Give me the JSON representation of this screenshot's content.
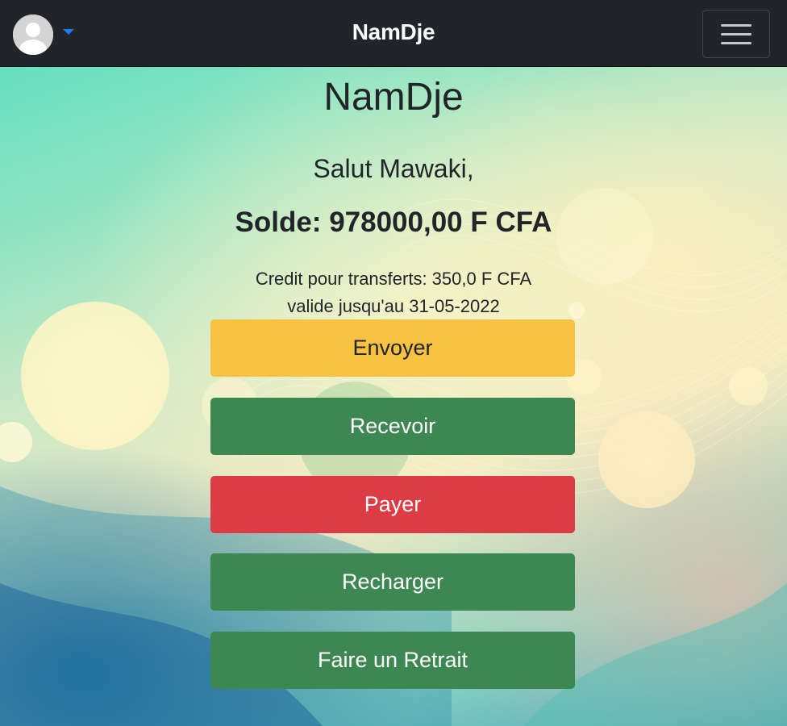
{
  "navbar": {
    "brand": "NamDje",
    "avatar_icon": "user-avatar-icon",
    "menu_icon": "hamburger-menu-icon",
    "caret_color": "#1e7cf2",
    "background": "#212529"
  },
  "main": {
    "title": "NamDje",
    "greeting": "Salut Mawaki,",
    "balance": "Solde: 978000,00 F CFA",
    "credit_line": "Credit pour transferts: 350,0 F CFA",
    "validity_line": "valide jusqu'au 31-05-2022"
  },
  "actions": {
    "send": "Envoyer",
    "receive": "Recevoir",
    "pay": "Payer",
    "top_up": "Recharger",
    "withdraw": "Faire un Retrait"
  },
  "colors": {
    "warning": "#f7c241",
    "success": "#3d8753",
    "danger": "#dc3c45"
  }
}
